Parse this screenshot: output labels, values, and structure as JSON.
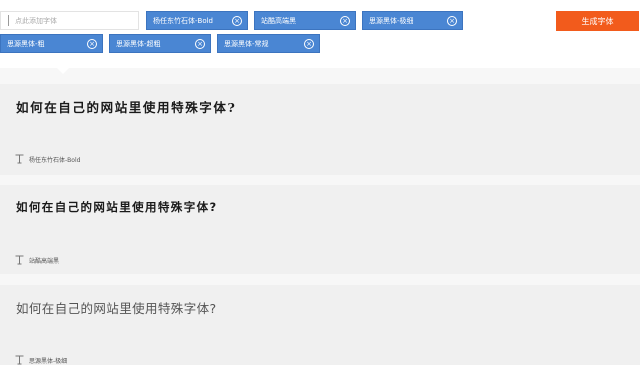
{
  "toolbar": {
    "font_input_placeholder": "点此添加字体",
    "generate_label": "生成字体",
    "selected_fonts": [
      {
        "label": "杨任东竹石体-Bold"
      },
      {
        "label": "站酷高端黑"
      },
      {
        "label": "思源黑体-极细"
      },
      {
        "label": "思源黑体-粗"
      },
      {
        "label": "思源黑体-超粗"
      },
      {
        "label": "思源黑体-常规"
      }
    ],
    "remove_icon": "close-icon",
    "accent_color": "#4a86d3",
    "button_color": "#f25b1c"
  },
  "previews": [
    {
      "sample_text": "如何在自己的网站里使用特殊字体?",
      "font_name": "杨任东竹石体-Bold"
    },
    {
      "sample_text": "如何在自己的网站里使用特殊字体?",
      "font_name": "站酷高端黑"
    },
    {
      "sample_text": "如何在自己的网站里使用特殊字体?",
      "font_name": "思源黑体-极细"
    }
  ],
  "preview_icon": "font-icon"
}
